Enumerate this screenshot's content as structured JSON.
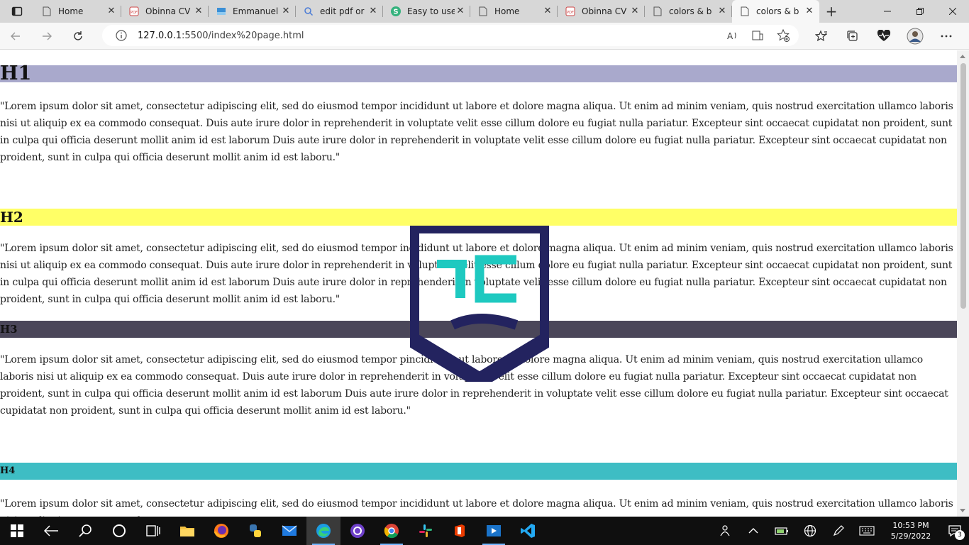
{
  "browser": {
    "tabs": [
      {
        "title": "Home",
        "icon": "page-icon"
      },
      {
        "title": "Obinna CV",
        "icon": "pdf-icon"
      },
      {
        "title": "Emmanuel",
        "icon": "image-icon"
      },
      {
        "title": "edit pdf or",
        "icon": "search-icon"
      },
      {
        "title": "Easy to use",
        "icon": "s-brand-icon"
      },
      {
        "title": "Home",
        "icon": "page-icon"
      },
      {
        "title": "Obinna CV",
        "icon": "pdf-icon"
      },
      {
        "title": "colors & b",
        "icon": "page-icon"
      },
      {
        "title": "colors & b",
        "icon": "page-icon"
      }
    ],
    "address": {
      "host": "127.0.0.1",
      "rest": ":5500/index%20page.html"
    }
  },
  "page": {
    "h1": "H1",
    "h2": "H2",
    "h3": "H3",
    "h4": "H4",
    "p1": "\"Lorem ipsum dolor sit amet, consectetur adipiscing elit, sed do eiusmod tempor incididunt ut labore et dolore magna aliqua. Ut enim ad minim veniam, quis nostrud exercitation ullamco laboris nisi ut aliquip ex ea commodo consequat. Duis aute irure dolor in reprehenderit in voluptate velit esse cillum dolore eu fugiat nulla pariatur. Excepteur sint occaecat cupidatat non proident, sunt in culpa qui officia deserunt mollit anim id est laborum Duis aute irure dolor in reprehenderit in voluptate velit esse cillum dolore eu fugiat nulla pariatur. Excepteur sint occaecat cupidatat non proident, sunt in culpa qui officia deserunt mollit anim id est laboru.\"",
    "p2": "\"Lorem ipsum dolor sit amet, consectetur adipiscing elit, sed do eiusmod tempor incididunt ut labore et dolore magna aliqua. Ut enim ad minim veniam, quis nostrud exercitation ullamco laboris nisi ut aliquip ex ea commodo consequat. Duis aute irure dolor in reprehenderit in voluptate velit esse cillum dolore eu fugiat nulla pariatur. Excepteur sint occaecat cupidatat non proident, sunt in culpa qui officia deserunt mollit anim id est laborum Duis aute irure dolor in reprehenderit in voluptate velit esse cillum dolore eu fugiat nulla pariatur. Excepteur sint occaecat cupidatat non proident, sunt in culpa qui officia deserunt mollit anim id est laboru.\"",
    "p3": "\"Lorem ipsum dolor sit amet, consectetur adipiscing elit, sed do eiusmod tempor pincididunt ut labore et dolore magna aliqua. Ut enim ad minim veniam, quis nostrud exercitation ullamco laboris nisi ut aliquip ex ea commodo consequat. Duis aute irure dolor in reprehenderit in voluptate velit esse cillum dolore eu fugiat nulla pariatur. Excepteur sint occaecat cupidatat non proident, sunt in culpa qui officia deserunt mollit anim id est laborum Duis aute irure dolor in reprehenderit in voluptate velit esse cillum dolore eu fugiat nulla pariatur. Excepteur sint occaecat cupidatat non proident, sunt in culpa qui officia deserunt mollit anim id est laboru.\"",
    "p4": "\"Lorem ipsum dolor sit amet, consectetur adipiscing elit, sed do eiusmod tempor incididunt ut labore et dolore magna aliqua. Ut enim ad minim veniam, quis nostrud exercitation ullamco laboris nisi ut aliquip ex ea commodo consequat.",
    "logo_text": "TC",
    "colors": {
      "h1_bg": "#a9a9cc",
      "h2_bg": "#ffff66",
      "h3_bg": "#4a4659",
      "h4_bg": "#3ebdc4",
      "logo_navy": "#23235f",
      "logo_teal": "#1ec9c0"
    }
  },
  "taskbar": {
    "time": "10:53 PM",
    "date": "5/29/2022",
    "notifications": "3"
  }
}
